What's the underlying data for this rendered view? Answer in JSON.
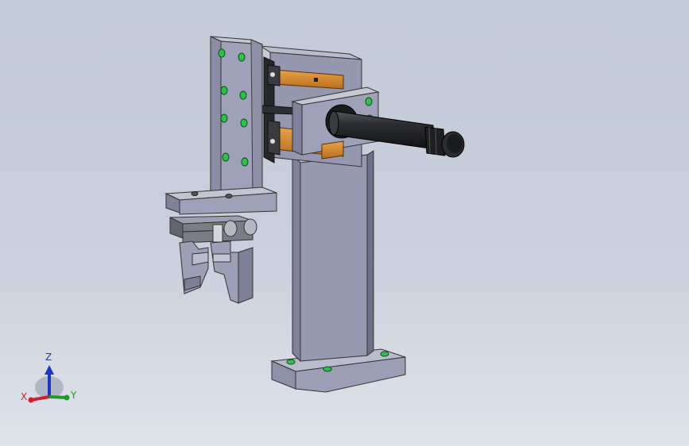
{
  "viewport": {
    "background_top": "#c4cbd8",
    "background_bottom": "#dfe3ea"
  },
  "model": {
    "body_color": "#9497ad",
    "body_light": "#b9bccd",
    "body_dark": "#6d7088",
    "rail_color": "#d98a2e",
    "cylinder_color": "#2a2b2f",
    "screw_color": "#2fbf4f"
  },
  "triad": {
    "x_label": "X",
    "y_label": "Y",
    "z_label": "Z",
    "x_color": "#d0202a",
    "y_color": "#1d9a2b",
    "z_color": "#1f35c9"
  }
}
